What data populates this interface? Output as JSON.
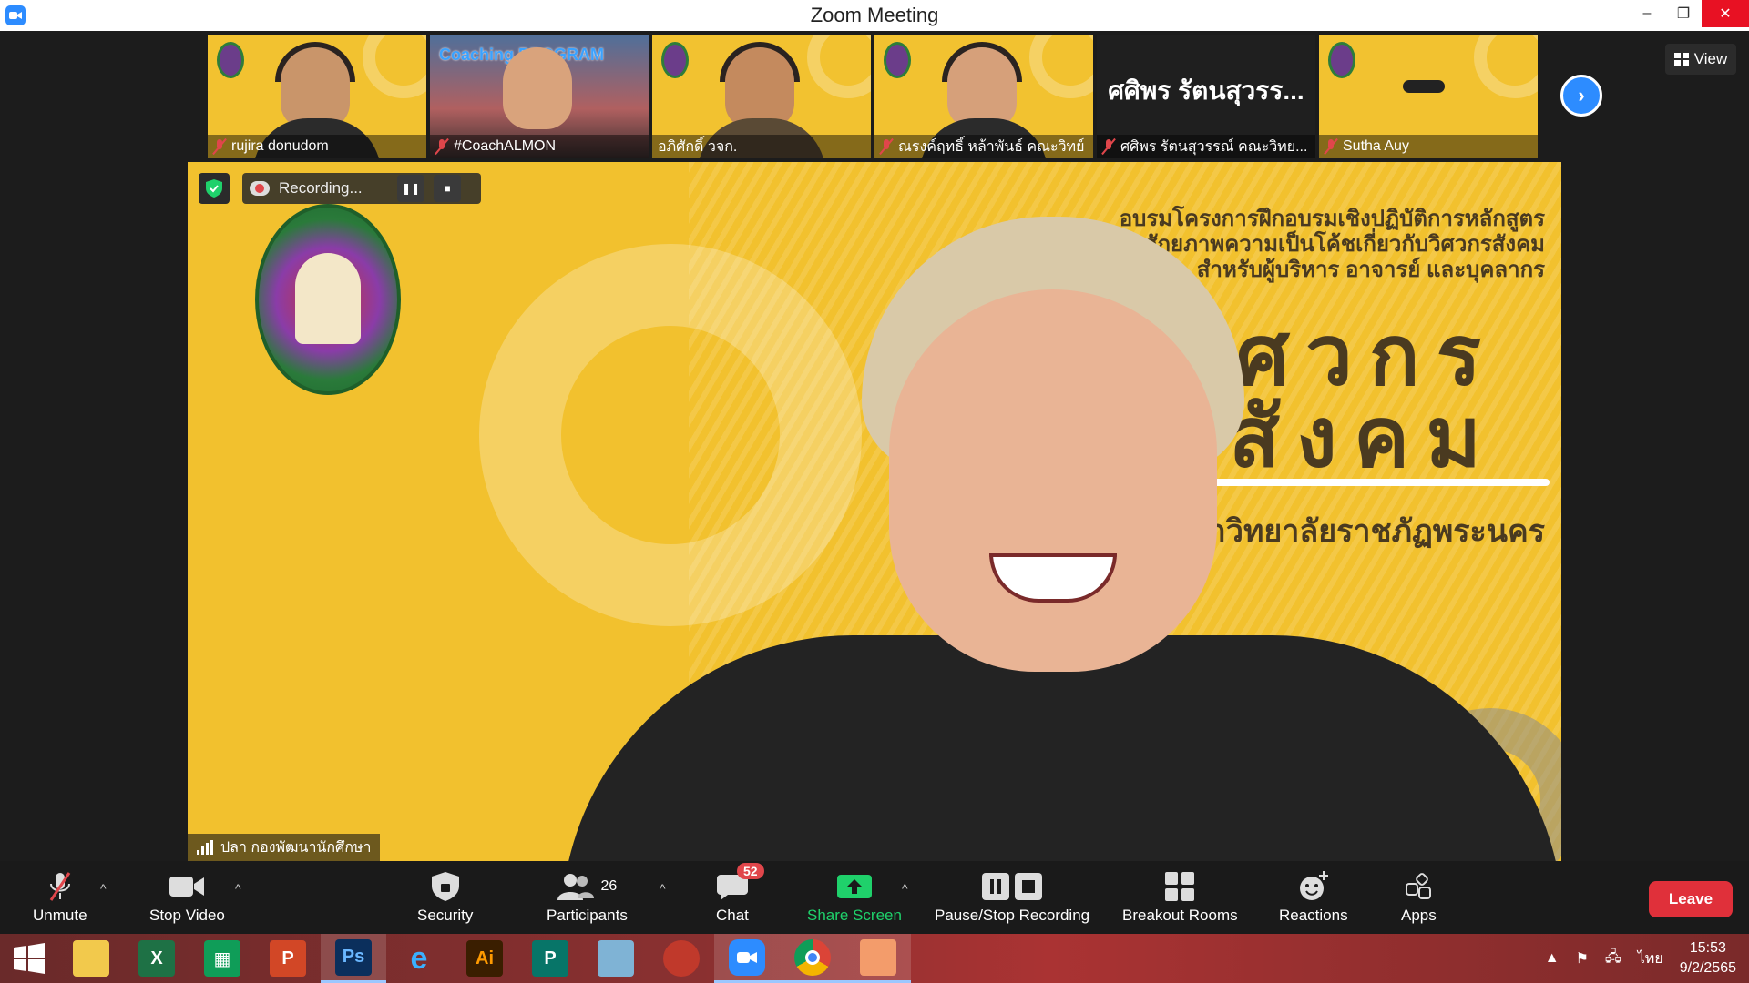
{
  "window": {
    "title": "Zoom Meeting",
    "controls": {
      "minimize": "–",
      "restore": "❐",
      "close": "✕"
    }
  },
  "gallery": {
    "thumbnails": [
      {
        "name": "rujira donudom",
        "muted": true
      },
      {
        "name": "#CoachALMON",
        "muted": true,
        "overlay_text": "Coaching PROGRAM"
      },
      {
        "name": "อภิศักดิ์ วจก.",
        "muted": false
      },
      {
        "name": "ณรงค์ฤทธิ์ หล้าพันธ์ คณะวิทย์",
        "muted": true
      },
      {
        "name": "ศศิพร รัตนสุวรรณ์ คณะวิทย...",
        "muted": true,
        "big_label": "ศศิพร รัตนสุวรร..."
      },
      {
        "name": "Sutha Auy",
        "muted": true
      }
    ],
    "next_icon": "chevron-right-icon",
    "view_label": "View"
  },
  "main": {
    "recording_label": "Recording...",
    "speaker_name": "ปลา กองพัฒนานักศึกษา",
    "slide": {
      "line1": "อบรมโครงการฝึกอบรมเชิงปฏิบัติการหลักสูตร",
      "line2": "รพัฒนาศักยภาพความเป็นโค้ชเกี่ยวกับวิศวกรสังคม",
      "line3": "สำหรับผู้บริหาร อาจารย์ และบุคลากร",
      "big1": "ศวกร",
      "big2": "สังคม",
      "university": "มหาวิทยาลัยราชภัฏพระนคร"
    }
  },
  "toolbar": {
    "unmute": "Unmute",
    "stop_video": "Stop Video",
    "security": "Security",
    "participants": "Participants",
    "participants_count": "26",
    "chat": "Chat",
    "chat_badge": "52",
    "share_screen": "Share Screen",
    "pause_stop_recording": "Pause/Stop Recording",
    "breakout_rooms": "Breakout Rooms",
    "reactions": "Reactions",
    "apps": "Apps",
    "leave": "Leave",
    "caret": "^"
  },
  "taskbar": {
    "apps": [
      "file-explorer",
      "excel",
      "store",
      "powerpoint",
      "photoshop",
      "internet-explorer",
      "illustrator",
      "publisher",
      "notepad",
      "photoscape",
      "zoom",
      "chrome",
      "paint"
    ],
    "tray_lang": "ไทย",
    "time": "15:53",
    "date": "9/2/2565"
  },
  "colors": {
    "zoom_blue": "#2d8cff",
    "leave_red": "#e0303a",
    "share_green": "#1fd16b",
    "slide_yellow": "#f2c12e"
  }
}
